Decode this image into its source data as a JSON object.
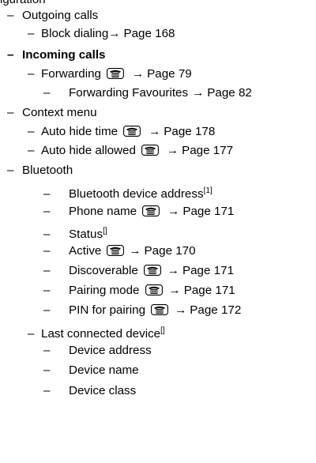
{
  "header": {
    "text": "iguration"
  },
  "items": [
    {
      "level": 1,
      "dash": "–",
      "text": "Outgoing calls",
      "bold": false
    },
    {
      "level": 2,
      "dash": "–",
      "text": "Block dialing",
      "arrow": "→",
      "page": "Page 168"
    },
    {
      "level": 1,
      "dash": "–",
      "text": "Incoming calls",
      "bold": true
    },
    {
      "level": 2,
      "dash": "–",
      "text": "Forwarding",
      "icon": "phone-icon",
      "arrow": "→",
      "page": "Page 79"
    },
    {
      "level": 3,
      "dash": "–",
      "text": "Forwarding Favourites",
      "arrow": "→",
      "page": "Page 82"
    },
    {
      "level": 1,
      "dash": "–",
      "text": "Context menu"
    },
    {
      "level": 2,
      "dash": "–",
      "text": "Auto hide time",
      "icon": "phone-icon",
      "arrow": "→",
      "page": "Page 178"
    },
    {
      "level": 2,
      "dash": "–",
      "text": "Auto hide allowed",
      "icon": "phone-icon",
      "arrow": "→",
      "page": "Page 177"
    },
    {
      "level": 1,
      "dash": "–",
      "text": "Bluetooth"
    },
    {
      "level": 3,
      "dash": "–",
      "text": "Bluetooth device address",
      "sup": "[1]"
    },
    {
      "level": 3,
      "dash": "–",
      "text": "Phone name",
      "icon": "phone-icon",
      "arrow": "→",
      "page": "Page 171"
    },
    {
      "level": 3,
      "dash": "–",
      "text": "Status",
      "sup": "[]"
    },
    {
      "level": 3,
      "dash": "–",
      "text": "Active",
      "icon": "phone-icon",
      "arrow": "→",
      "page": "Page 170"
    },
    {
      "level": 3,
      "dash": "–",
      "text": "Discoverable",
      "icon": "phone-icon",
      "arrow": "→",
      "page": "Page 171"
    },
    {
      "level": 3,
      "dash": "–",
      "text": "Pairing mode",
      "icon": "phone-icon",
      "arrow": "→",
      "page": "Page 171"
    },
    {
      "level": 3,
      "dash": "–",
      "text": "PIN for pairing",
      "icon": "phone-icon",
      "arrow": "→",
      "page": "Page 172"
    },
    {
      "level": 2,
      "dash": "–",
      "text": "Last connected device",
      "sup": "[]"
    },
    {
      "level": 3,
      "dash": "–",
      "text": "Device address"
    },
    {
      "level": 3,
      "dash": "–",
      "text": "Device name"
    },
    {
      "level": 3,
      "dash": "–",
      "text": "Device class"
    }
  ]
}
